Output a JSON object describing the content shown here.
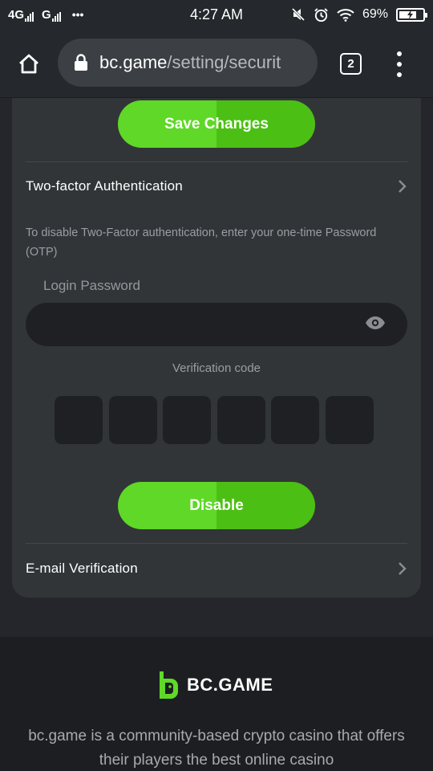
{
  "status_bar": {
    "network1": "4G",
    "network2": "G",
    "dots": "•••",
    "time": "4:27 AM",
    "battery_pct": "69%",
    "battery_level": 0.69
  },
  "browser": {
    "url_host": "bc.game",
    "url_path": "/setting/securit",
    "tab_count": "2"
  },
  "card": {
    "save_label": "Save Changes",
    "two_factor_label": "Two-factor Authentication",
    "description": "To disable Two-Factor authentication, enter your one-time Password (OTP)",
    "password_label": "Login Password",
    "password_value": "",
    "verification_label": "Verification code",
    "code_digits": [
      "",
      "",
      "",
      "",
      "",
      ""
    ],
    "disable_label": "Disable",
    "email_label": "E-mail Verification"
  },
  "footer": {
    "brand_name": "BC.GAME",
    "text": "bc.game is a community-based crypto casino that offers their players the best online casino"
  },
  "colors": {
    "accent_green": "#5fd827",
    "background": "#24262b",
    "card": "#323538"
  }
}
